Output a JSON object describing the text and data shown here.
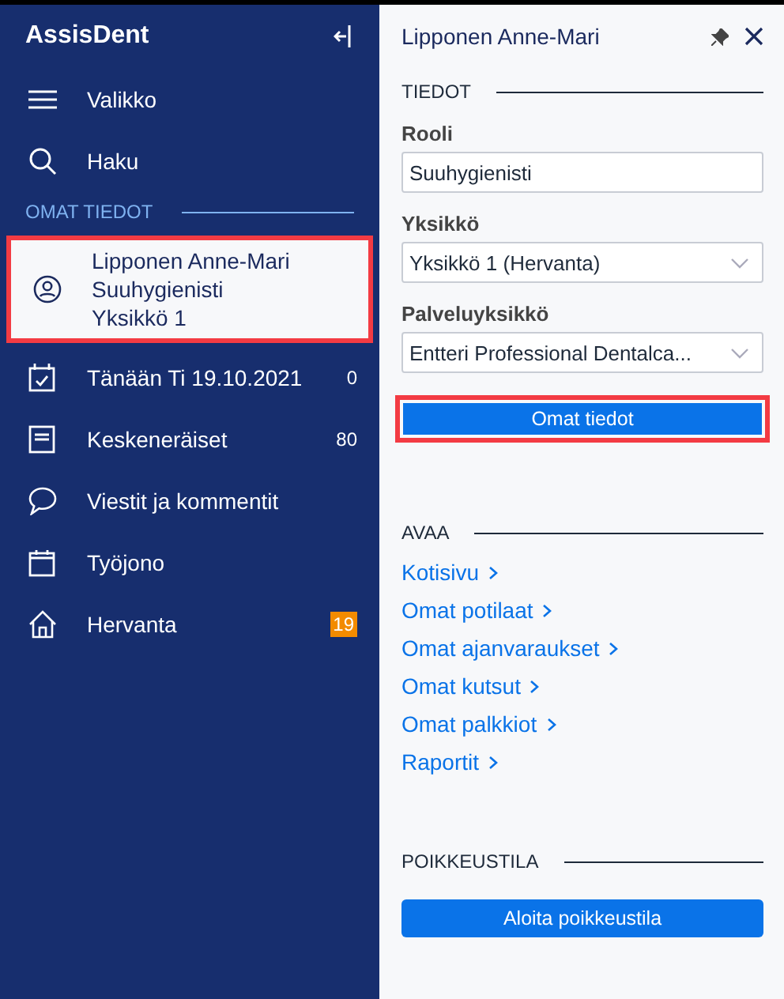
{
  "sidebar": {
    "logo": "AssisDent",
    "top_items": [
      {
        "label": "Valikko"
      },
      {
        "label": "Haku"
      }
    ],
    "section_title": "OMAT TIEDOT",
    "profile": {
      "name": "Lipponen Anne-Mari",
      "role": "Suuhygienisti",
      "unit": "Yksikkö 1",
      "highlighted": true
    },
    "items": [
      {
        "label": "Tänään Ti 19.10.2021",
        "count": "0",
        "count_highlight": false
      },
      {
        "label": "Keskeneräiset",
        "count": "80",
        "count_highlight": false
      },
      {
        "label": "Viestit ja kommentit"
      },
      {
        "label": "Työjono"
      },
      {
        "label": "Hervanta",
        "count": "19",
        "count_highlight": true
      }
    ]
  },
  "panel": {
    "title": "Lipponen Anne-Mari",
    "sections": [
      {
        "title": "TIEDOT",
        "fields": [
          {
            "kind": "text",
            "label": "Rooli",
            "value": "Suuhygienisti"
          },
          {
            "kind": "select",
            "label": "Yksikkö",
            "value": "Yksikkö 1 (Hervanta)"
          },
          {
            "kind": "select",
            "label": "Palveluyksikkö",
            "value": "Entteri Professional Dentalca..."
          }
        ],
        "button": {
          "label": "Omat tiedot",
          "highlighted": true
        }
      },
      {
        "title": "AVAA",
        "links": [
          "Kotisivu",
          "Omat potilaat",
          "Omat ajanvaraukset",
          "Omat kutsut",
          "Omat palkkiot",
          "Raportit"
        ]
      },
      {
        "title": "POIKKEUSTILA",
        "button": {
          "label": "Aloita poikkeustila",
          "highlighted": false
        }
      }
    ]
  }
}
